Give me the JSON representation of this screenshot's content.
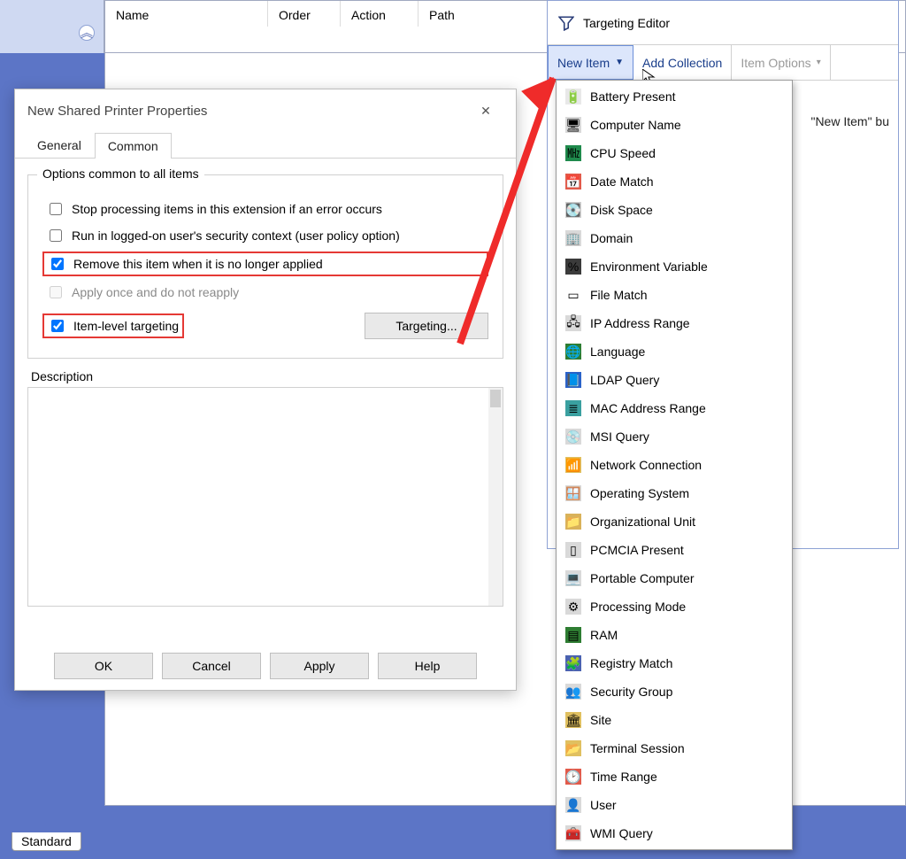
{
  "list": {
    "columns": {
      "name": "Name",
      "order": "Order",
      "action": "Action",
      "path": "Path"
    }
  },
  "bottom_tabs": {
    "standard": "Standard"
  },
  "sidebar": {
    "collapse_glyph": "︽"
  },
  "dialog": {
    "title": "New Shared Printer Properties",
    "tabs": {
      "general": "General",
      "common": "Common"
    },
    "group_legend": "Options common to all items",
    "opts": {
      "stop_processing": "Stop processing items in this extension if an error occurs",
      "run_user_ctx": "Run in logged-on user's security context (user policy option)",
      "remove_unapplied": "Remove this item when it is no longer applied",
      "apply_once": "Apply once and do not reapply",
      "item_targeting": "Item-level targeting"
    },
    "targeting_btn": "Targeting...",
    "description_label": "Description",
    "buttons": {
      "ok": "OK",
      "cancel": "Cancel",
      "apply": "Apply",
      "help": "Help"
    }
  },
  "te": {
    "title": "Targeting Editor",
    "toolbar": {
      "new_item": "New Item",
      "add_collection": "Add Collection",
      "item_options": "Item Options"
    },
    "hint_fragment": "\"New Item\" bu"
  },
  "menu": {
    "items": [
      {
        "label": "Battery Present",
        "glyph": "🔋",
        "bg": "#e8e8e8"
      },
      {
        "label": "Computer Name",
        "glyph": "🖥",
        "bg": "#d9d9d9"
      },
      {
        "label": "CPU Speed",
        "glyph": "㎒",
        "bg": "#1f8a4c"
      },
      {
        "label": "Date Match",
        "glyph": "📅",
        "bg": "#e25a4a"
      },
      {
        "label": "Disk Space",
        "glyph": "💽",
        "bg": "#cfcfcf"
      },
      {
        "label": "Domain",
        "glyph": "🏢",
        "bg": "#d9d9d9"
      },
      {
        "label": "Environment Variable",
        "glyph": "%",
        "bg": "#3b3b3b"
      },
      {
        "label": "File Match",
        "glyph": "▭",
        "bg": "#ffffff"
      },
      {
        "label": "IP Address Range",
        "glyph": "🖧",
        "bg": "#d9d9d9"
      },
      {
        "label": "Language",
        "glyph": "🌐",
        "bg": "#2e7d32"
      },
      {
        "label": "LDAP Query",
        "glyph": "📘",
        "bg": "#2a62c9"
      },
      {
        "label": "MAC Address Range",
        "glyph": "≣",
        "bg": "#3aa0a0"
      },
      {
        "label": "MSI Query",
        "glyph": "💿",
        "bg": "#d9d9d9"
      },
      {
        "label": "Network Connection",
        "glyph": "📶",
        "bg": "#e0c060"
      },
      {
        "label": "Operating System",
        "glyph": "🪟",
        "bg": "#d9d9d9"
      },
      {
        "label": "Organizational Unit",
        "glyph": "📁",
        "bg": "#d9b25a"
      },
      {
        "label": "PCMCIA Present",
        "glyph": "▯",
        "bg": "#d9d9d9"
      },
      {
        "label": "Portable Computer",
        "glyph": "💻",
        "bg": "#d9d9d9"
      },
      {
        "label": "Processing Mode",
        "glyph": "⚙",
        "bg": "#d9d9d9"
      },
      {
        "label": "RAM",
        "glyph": "▤",
        "bg": "#2e7d32"
      },
      {
        "label": "Registry Match",
        "glyph": "🧩",
        "bg": "#4a62b0"
      },
      {
        "label": "Security Group",
        "glyph": "👥",
        "bg": "#d9d9d9"
      },
      {
        "label": "Site",
        "glyph": "🏛",
        "bg": "#e0c060"
      },
      {
        "label": "Terminal Session",
        "glyph": "📂",
        "bg": "#e0c060"
      },
      {
        "label": "Time Range",
        "glyph": "🕑",
        "bg": "#e25a4a"
      },
      {
        "label": "User",
        "glyph": "👤",
        "bg": "#d9d9d9"
      },
      {
        "label": "WMI Query",
        "glyph": "🧰",
        "bg": "#d9d9d9"
      }
    ]
  }
}
